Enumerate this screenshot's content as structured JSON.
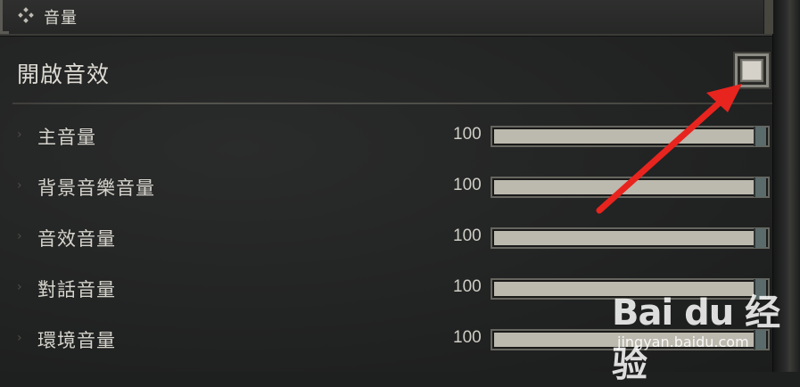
{
  "header": {
    "title": "音量",
    "icon": "diamond-dots-icon"
  },
  "master": {
    "label": "開啟音效",
    "checked": false
  },
  "rows": [
    {
      "label": "主音量",
      "value": "100",
      "level": 1.0
    },
    {
      "label": "背景音樂音量",
      "value": "100",
      "level": 1.0
    },
    {
      "label": "音效音量",
      "value": "100",
      "level": 1.0
    },
    {
      "label": "對話音量",
      "value": "100",
      "level": 1.0
    },
    {
      "label": "環境音量",
      "value": "100",
      "level": 1.0
    }
  ],
  "annotation": {
    "arrow_color": "#e8241e"
  },
  "watermark": {
    "logo": "Bai du 经验",
    "url": "jingyan.baidu.com"
  }
}
